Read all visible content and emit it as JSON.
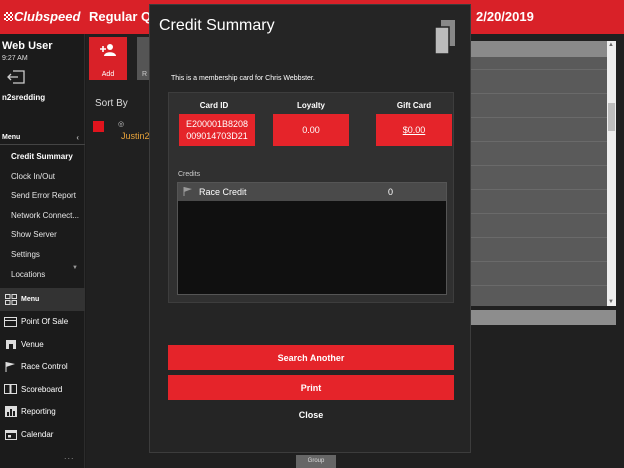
{
  "app": {
    "logo": "Clubspeed",
    "title_partial": "Regular Qu",
    "date_partial": "2/20/2019"
  },
  "sidebar": {
    "user_name": "Web User",
    "time": "9:27 AM",
    "site": "n2sredding",
    "menu_header": "Menu",
    "menu_items": [
      {
        "label": "Credit Summary"
      },
      {
        "label": "Clock In/Out"
      },
      {
        "label": "Send Error Report"
      },
      {
        "label": "Network Connect..."
      },
      {
        "label": "Show Server"
      },
      {
        "label": "Settings"
      },
      {
        "label": "Locations"
      }
    ],
    "nav_items": [
      {
        "label": "Menu",
        "icon": "grid-icon"
      },
      {
        "label": "Point Of Sale",
        "icon": "register-icon"
      },
      {
        "label": "Venue",
        "icon": "venue-icon"
      },
      {
        "label": "Race Control",
        "icon": "flag-icon"
      },
      {
        "label": "Scoreboard",
        "icon": "scoreboard-icon"
      },
      {
        "label": "Reporting",
        "icon": "chart-icon"
      },
      {
        "label": "Calendar",
        "icon": "calendar-icon"
      }
    ],
    "more": "..."
  },
  "main": {
    "add_label": "Add",
    "r_label": "R",
    "sort_by": "Sort By",
    "racer_name": "Justin2",
    "group_label": "Group"
  },
  "modal": {
    "title": "Credit Summary",
    "note": "This is a membership card for Chris Webbster.",
    "card_id_header": "Card ID",
    "card_id_value": "E200001B8208\n009014703D21",
    "loyalty_header": "Loyalty",
    "loyalty_value": "0.00",
    "gift_card_header": "Gift Card",
    "gift_card_value": "$0.00",
    "credits_label": "Credits",
    "credits": [
      {
        "name": "Race Credit",
        "value": "0"
      }
    ],
    "search_another": "Search Another",
    "print": "Print",
    "close": "Close"
  },
  "colors": {
    "brand_red": "#d92128",
    "button_red": "#e5242a",
    "racer_orange": "#e8a33a"
  }
}
